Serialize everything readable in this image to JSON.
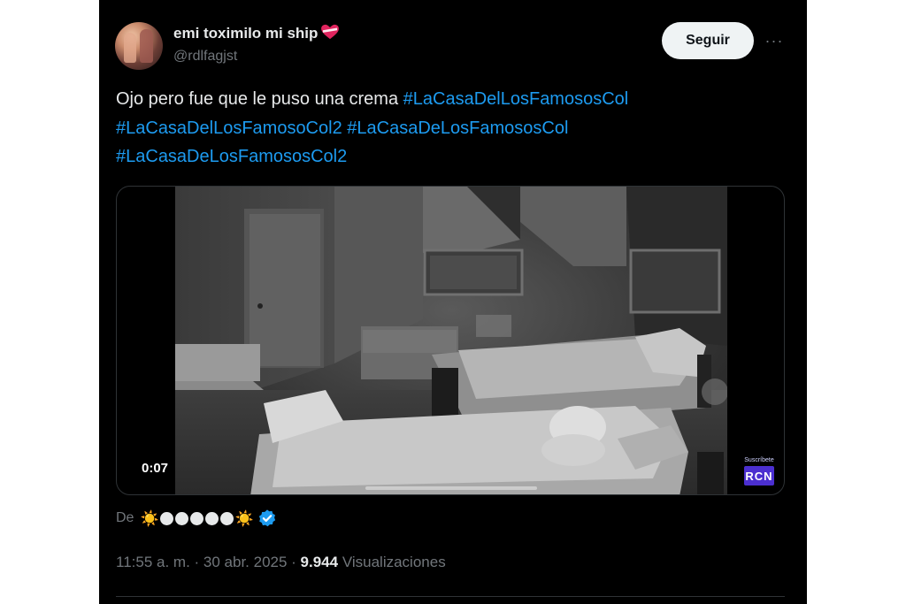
{
  "author": {
    "name": "emi   toximilo mi ship",
    "handle": "@rdlfagjst",
    "name_icon": "heart-emoji-icon"
  },
  "actions": {
    "follow_label": "Seguir",
    "more_label": "···"
  },
  "tweet": {
    "text": "Ojo pero fue que le puso una crema",
    "hashtags": [
      "#LaCasaDelLosFamososCol",
      "#LaCasaDelLosFamosoCol2",
      "#LaCasaDeLosFamososCol",
      "#LaCasaDeLosFamososCol2"
    ]
  },
  "media": {
    "duration": "0:07",
    "watermark_text": "Suscríbete",
    "watermark_logo": "RCN",
    "progress": 0.05
  },
  "source": {
    "label": "De",
    "sun": "☀️",
    "dot_count": 5
  },
  "meta": {
    "time": "11:55 a. m.",
    "separator": " · ",
    "date": "30 abr. 2025",
    "views_count": "9.944",
    "views_label": "Visualizaciones"
  },
  "colors": {
    "background": "#000000",
    "text": "#e7e9ea",
    "muted": "#71767b",
    "hashtag": "#1d9bf0",
    "button_bg": "#eff3f4",
    "verified": "#1d9bf0"
  }
}
